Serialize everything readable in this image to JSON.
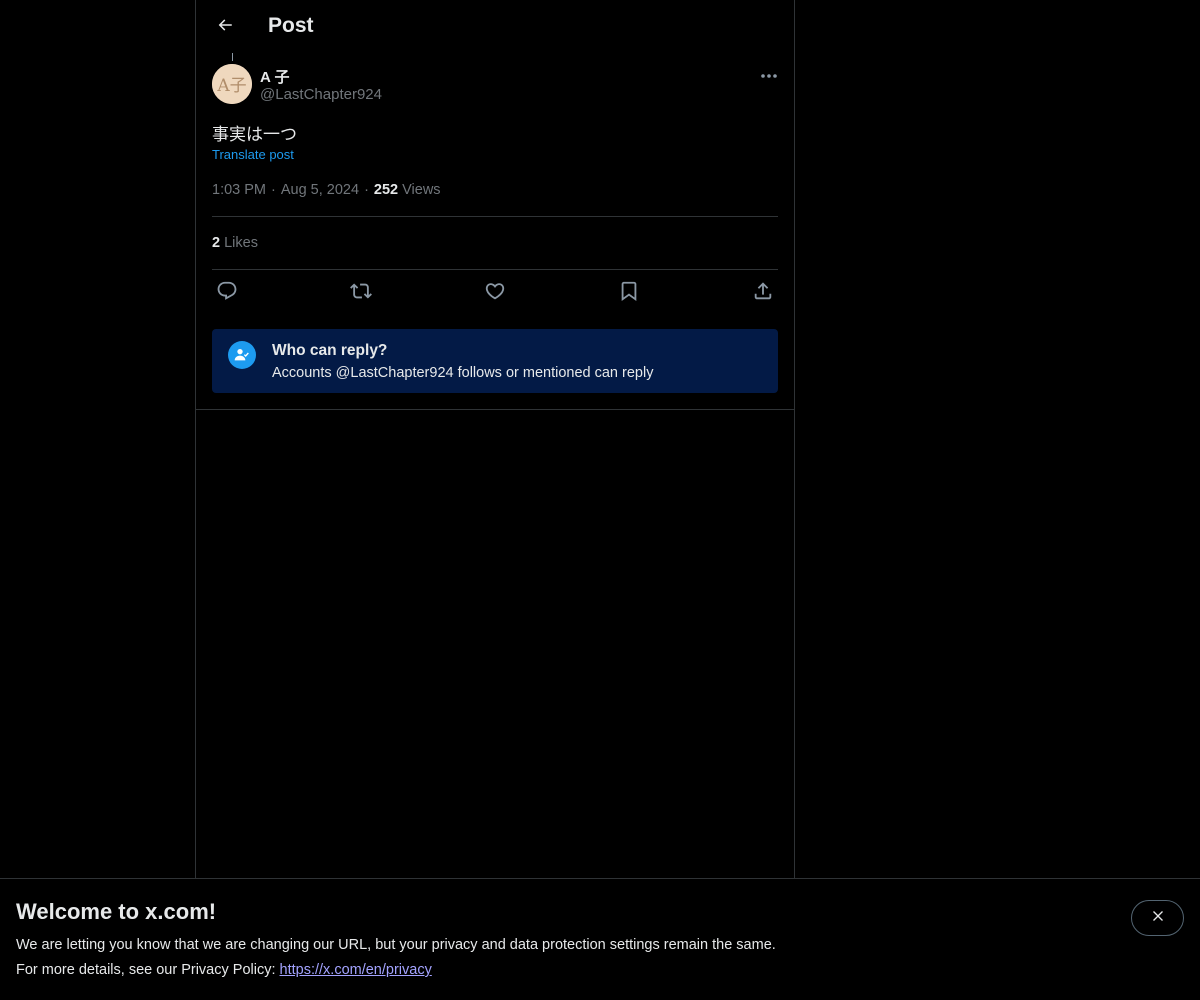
{
  "header": {
    "title": "Post",
    "back_icon": "arrow-left-icon"
  },
  "post": {
    "author": {
      "name": "A 子",
      "handle": "@LastChapter924",
      "avatar_text": "A子"
    },
    "text": "事実は一つ",
    "translate_label": "Translate post",
    "time": "1:03 PM",
    "date": "Aug 5, 2024",
    "views_count": "252",
    "views_label": "Views",
    "likes_count": "2",
    "likes_label": "Likes",
    "actions": [
      "reply-icon",
      "repost-icon",
      "like-icon",
      "bookmark-icon",
      "share-icon"
    ]
  },
  "reply_restriction": {
    "title": "Who can reply?",
    "description": "Accounts @LastChapter924 follows or mentioned can reply",
    "icon": "person-check-icon"
  },
  "banner": {
    "title": "Welcome to x.com!",
    "line1": "We are letting you know that we are changing our URL, but your privacy and data protection settings remain the same.",
    "line2_prefix": "For more details, see our Privacy Policy: ",
    "link": "https://x.com/en/privacy",
    "close_icon": "close-icon"
  },
  "colors": {
    "background": "#000000",
    "text_primary": "#e7e9ea",
    "text_secondary": "#71767b",
    "accent": "#1d9bf0",
    "reply_box": "#031a46",
    "link": "#a3a3ff"
  }
}
